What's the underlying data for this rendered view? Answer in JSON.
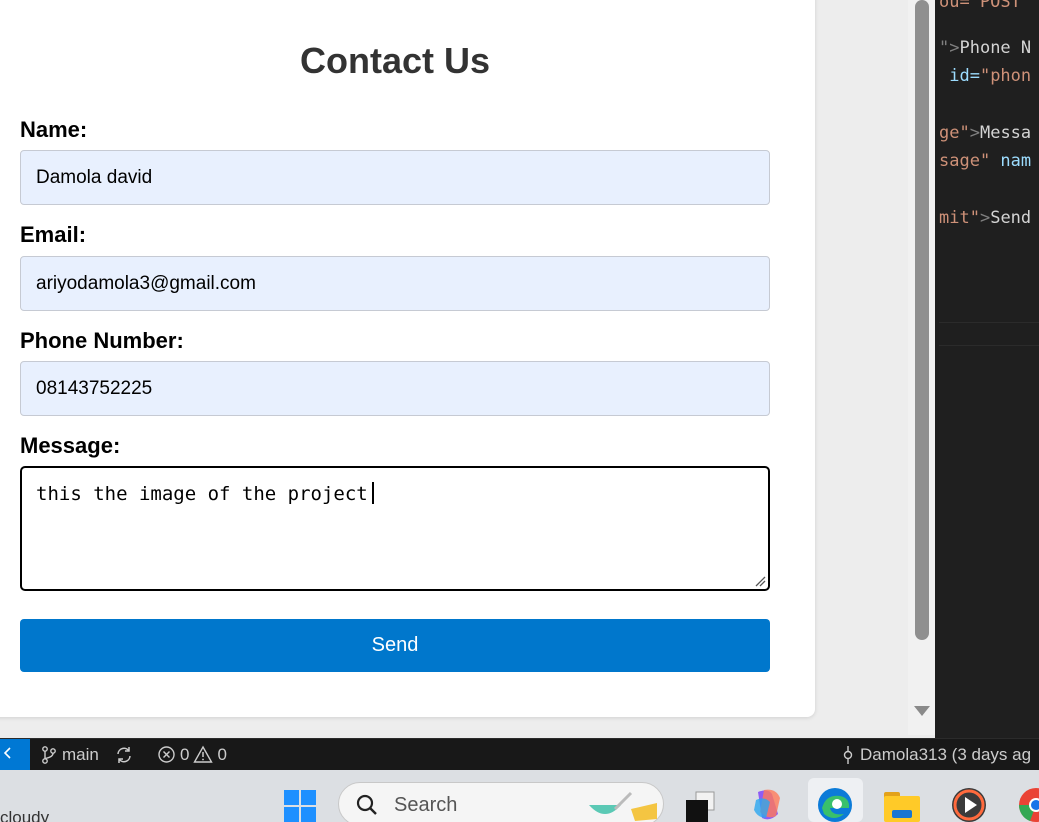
{
  "form": {
    "title": "Contact Us",
    "name_label": "Name:",
    "name_value": "Damola david",
    "email_label": "Email:",
    "email_value": "ariyodamola3@gmail.com",
    "phone_label": "Phone Number:",
    "phone_value": "08143752225",
    "message_label": "Message:",
    "message_value": "this the image of the project",
    "send_label": "Send"
  },
  "editor": {
    "line1": "ou= POST",
    "line2_punc": "\">",
    "line2_text": "Phone N",
    "line3_attr": " id=",
    "line3_str": "\"phon",
    "line4_str": "ge\"",
    "line4_punc": ">",
    "line4_text": "Messa",
    "line5_str": "sage\"",
    "line5_attr": " nam",
    "line6_str": "mit\"",
    "line6_punc": ">",
    "line6_text": "Send"
  },
  "statusbar": {
    "branch": "main",
    "errors": "0",
    "warnings": "0",
    "blame": "Damola313 (3 days ag"
  },
  "taskbar": {
    "weather": "cloudy",
    "search_placeholder": "Search"
  },
  "colors": {
    "accent": "#0077cc",
    "input_bg": "#e8f0fe",
    "statusbar_bg": "#181818",
    "remote_button": "#0078d4"
  }
}
